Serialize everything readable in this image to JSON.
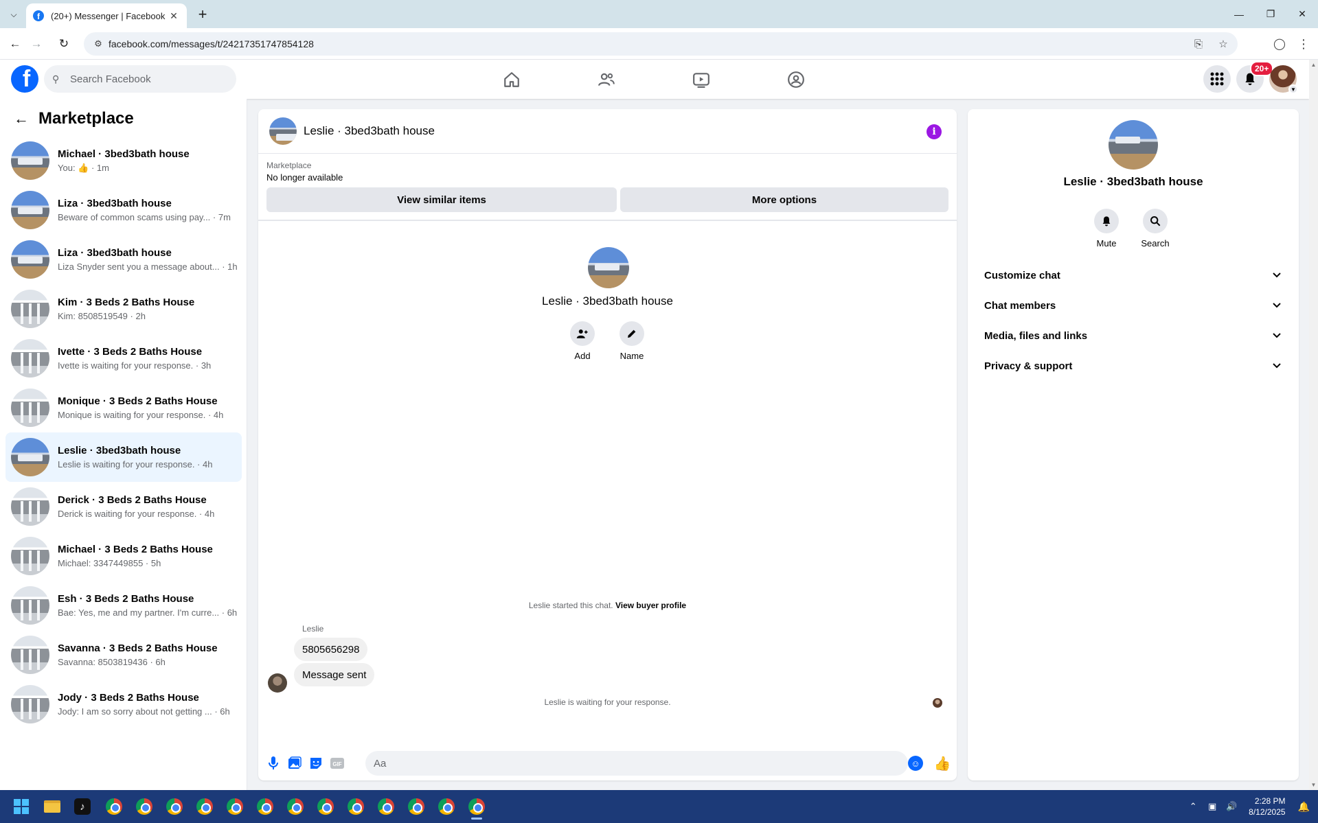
{
  "browser": {
    "tab_title": "(20+) Messenger | Facebook",
    "url": "facebook.com/messages/t/24217351747854128"
  },
  "header": {
    "search_placeholder": "Search Facebook",
    "notifications_badge": "20+"
  },
  "sidebar": {
    "title": "Marketplace",
    "conversations": [
      {
        "name": "Michael · 3bed3bath house",
        "preview": "You: 👍 · 1m",
        "avatar": "house-blue-sky"
      },
      {
        "name": "Liza · 3bed3bath house",
        "preview": "Beware of common scams using pay... · 7m",
        "avatar": "house-blue-sky"
      },
      {
        "name": "Liza · 3bed3bath house",
        "preview": "Liza Snyder sent you a message about... · 1h",
        "avatar": "house-blue-sky"
      },
      {
        "name": "Kim · 3 Beds 2 Baths House",
        "preview": "Kim: 8508519549 · 2h",
        "avatar": "house-porch"
      },
      {
        "name": "Ivette · 3 Beds 2 Baths House",
        "preview": "Ivette is waiting for your response. · 3h",
        "avatar": "house-porch"
      },
      {
        "name": "Monique · 3 Beds 2 Baths House",
        "preview": "Monique is waiting for your response. · 4h",
        "avatar": "house-porch"
      },
      {
        "name": "Leslie · 3bed3bath house",
        "preview": "Leslie is waiting for your response. · 4h",
        "avatar": "house-blue-sky",
        "active": true
      },
      {
        "name": "Derick · 3 Beds 2 Baths House",
        "preview": "Derick is waiting for your response. · 4h",
        "avatar": "house-porch"
      },
      {
        "name": "Michael · 3 Beds 2 Baths House",
        "preview": "Michael: 3347449855 · 5h",
        "avatar": "house-porch"
      },
      {
        "name": "Esh · 3 Beds 2 Baths House",
        "preview": "Bae: Yes, me and my partner. I'm curre... · 6h",
        "avatar": "house-porch"
      },
      {
        "name": "Savanna · 3 Beds 2 Baths House",
        "preview": "Savanna: 8503819436 · 6h",
        "avatar": "house-porch"
      },
      {
        "name": "Jody · 3 Beds 2 Baths House",
        "preview": "Jody: I am so sorry about not getting ... · 6h",
        "avatar": "house-porch"
      }
    ]
  },
  "chat": {
    "title": "Leslie · 3bed3bath house",
    "marketplace_label": "Marketplace",
    "listing_status": "No longer available",
    "view_similar_label": "View similar items",
    "more_options_label": "More options",
    "intro_name": "Leslie · 3bed3bath house",
    "add_label": "Add",
    "name_label": "Name",
    "started_text": "Leslie started this chat.",
    "view_buyer_label": "View buyer profile",
    "sender": "Leslie",
    "messages": [
      "5805656298",
      "Message sent"
    ],
    "waiting_text": "Leslie is waiting for your response.",
    "composer_placeholder": "Aa"
  },
  "info_panel": {
    "name": "Leslie · 3bed3bath house",
    "mute_label": "Mute",
    "search_label": "Search",
    "sections": [
      "Customize chat",
      "Chat members",
      "Media, files and links",
      "Privacy & support"
    ]
  },
  "taskbar": {
    "time": "2:28 PM",
    "date": "8/12/2025"
  },
  "colors": {
    "brand": "#0866ff",
    "active_row": "#ebf5ff",
    "info_icon": "#9b17e3",
    "badge": "#e41e3f"
  }
}
